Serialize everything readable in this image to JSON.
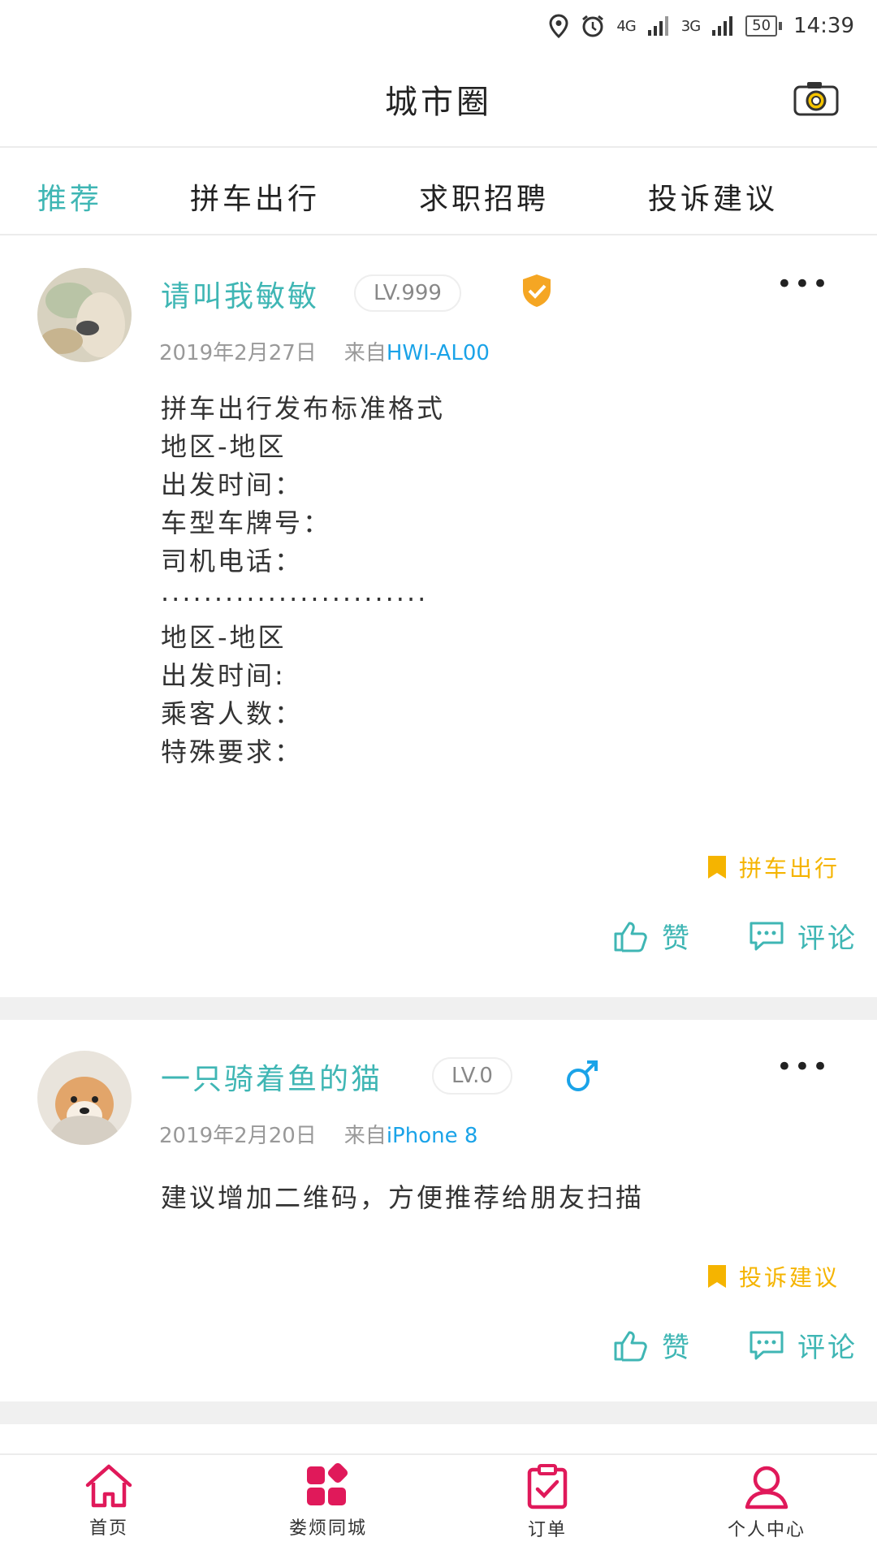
{
  "status_bar": {
    "net1": "4G",
    "net2": "3G",
    "battery": "50",
    "time": "14:39"
  },
  "header": {
    "title": "城市圈"
  },
  "tabs": [
    {
      "label": "推荐",
      "active": true
    },
    {
      "label": "拼车出行",
      "active": false
    },
    {
      "label": "求职招聘",
      "active": false
    },
    {
      "label": "投诉建议",
      "active": false
    }
  ],
  "posts": [
    {
      "username": "请叫我敏敏",
      "level": "LV.999",
      "badge_icon": "shield-check-icon",
      "date": "2019年2月27日",
      "from_label": "来自",
      "device": "HWI-AL00",
      "content": "拼车出行发布标准格式\n地区-地区\n出发时间：\n车型车牌号：\n司机电话：\n·························\n地区-地区\n出发时间:\n乘客人数：\n特殊要求：",
      "tag": "拼车出行",
      "like_label": "赞",
      "comment_label": "评论"
    },
    {
      "username": "一只骑着鱼的猫",
      "level": "LV.0",
      "badge_icon": "male-icon",
      "date": "2019年2月20日",
      "from_label": "来自",
      "device": "iPhone 8",
      "content": "建议增加二维码，方便推荐给朋友扫描",
      "tag": "投诉建议",
      "like_label": "赞",
      "comment_label": "评论"
    }
  ],
  "bottom_nav": [
    {
      "label": "首页",
      "icon": "home-icon"
    },
    {
      "label": "娄烦同城",
      "icon": "apps-icon"
    },
    {
      "label": "订单",
      "icon": "clipboard-check-icon"
    },
    {
      "label": "个人中心",
      "icon": "user-icon"
    }
  ],
  "colors": {
    "accent": "#3fb6b4",
    "link": "#1aa3e8",
    "tag": "#f5b400",
    "nav": "#e0195a"
  }
}
